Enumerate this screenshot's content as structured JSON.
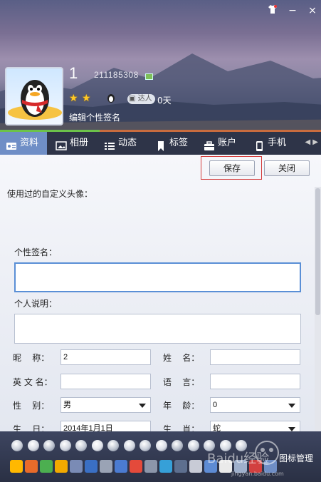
{
  "window": {
    "close_glyph": "×",
    "minimize_glyph": "−",
    "skin_icon": "shirt-icon"
  },
  "profile": {
    "nickname": "1",
    "qq_number": "211185308",
    "level_stars": 2,
    "badge_label": "达人",
    "days": "0天",
    "signature_prompt": "编辑个性签名",
    "star_color": "#ffc926"
  },
  "tabs": [
    {
      "label": "资料",
      "icon": "id-card-icon",
      "active": true
    },
    {
      "label": "相册",
      "icon": "photo-album-icon",
      "active": false
    },
    {
      "label": "动态",
      "icon": "list-icon",
      "active": false
    },
    {
      "label": "标签",
      "icon": "bookmark-icon",
      "active": false
    },
    {
      "label": "账户",
      "icon": "briefcase-icon",
      "active": false
    },
    {
      "label": "手机",
      "icon": "phone-icon",
      "active": false
    }
  ],
  "toolbar": {
    "save_label": "保存",
    "close_label": "关闭",
    "highlight_color": "#d43d3d"
  },
  "form": {
    "custom_avatar_label": "使用过的自定义头像：",
    "signature_label": "个性签名：",
    "signature_value": "",
    "description_label": "个人说明：",
    "description_value": "",
    "nickname_label": "昵    称：",
    "nickname_value": "2",
    "name_label": "姓    名：",
    "name_value": "",
    "english_name_label": "英 文 名：",
    "english_name_value": "",
    "language_label": "语    言：",
    "language_value": "",
    "gender_label": "性    别：",
    "gender_value": "男",
    "age_label": "年    龄：",
    "age_value": "0",
    "birthday_label": "生    日：",
    "birthday_value": "2014年1月1日",
    "zodiac_label": "生    肖：",
    "zodiac_value": "蛇"
  },
  "bottom": {
    "management_label": "图标管理",
    "watermark_text": "Baidu经验",
    "watermark_url": "jingyan.baidu.com"
  },
  "colors": {
    "tab_bar": "#2e3448",
    "tab_active": "#6f8ec6",
    "focus_border": "#5a8fd6"
  }
}
